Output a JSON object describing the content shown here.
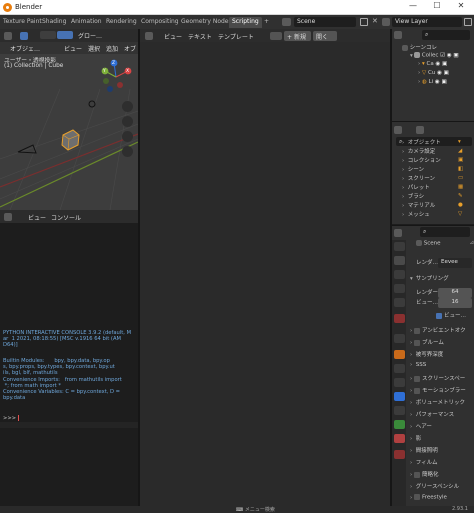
{
  "app": {
    "title": "Blender",
    "version": "2.93.1"
  },
  "window_buttons": [
    "—",
    "☐",
    "✕"
  ],
  "workspace_tabs": [
    "Texture Paint",
    "Shading",
    "Animation",
    "Rendering",
    "Compositing",
    "Geometry Nodes",
    "Scripting",
    "+"
  ],
  "scene": {
    "label": "Scene",
    "view_layer": "View Layer"
  },
  "viewport": {
    "mode": "オブジェ…",
    "menus": [
      "ビュー",
      "選択",
      "追加",
      "オブ"
    ],
    "transform": "グロー…",
    "info_line1": "ユーザー・透視投影",
    "info_line2": "(1) Collection | Cube",
    "gizmo_axes": [
      "Y",
      "X",
      "Z"
    ]
  },
  "console": {
    "menus": [
      "ビュー",
      "コンソール"
    ],
    "banner": "PYTHON INTERACTIVE CONSOLE 3.9.2 (default, M\nar  1 2021, 08:18:55) [MSC v.1916 64 bit (AM\nD64)]",
    "builtins": "Builtin Modules:      bpy, bpy.data, bpy.op\ns, bpy.props, bpy.types, bpy.context, bpy.ut\nils, bgl, blf, mathutils\nConvenience Imports:   from mathutils import\n *; from math import *\nConvenience Variables: C = bpy.context, D =\nbpy.data",
    "prompt": ">>> "
  },
  "text_editor": {
    "menus": [
      "ビュー",
      "テキスト",
      "テンプレート"
    ],
    "new_label": "新規",
    "open_label": "開く"
  },
  "outliner": {
    "title": "シーンコレ",
    "items": [
      {
        "label": "Collec"
      },
      {
        "label": "Ca"
      },
      {
        "label": "Cu"
      },
      {
        "label": "Li"
      }
    ]
  },
  "data_browser": {
    "items": [
      "オブジェクト",
      "カメラ設定",
      "コレクション",
      "シーン",
      "スクリーン",
      "パレット",
      "ブラシ",
      "マテリアル",
      "メッシュ"
    ]
  },
  "properties": {
    "scene_label": "Scene",
    "render_engine_label": "レンダ…",
    "render_engine_value": "Eevee",
    "sampling": "サンプリング",
    "render_samples_label": "レンダー",
    "render_samples": "64",
    "viewport_samples_label": "ビュー…",
    "viewport_samples": "16",
    "viewport_denoise": "ビュー…",
    "panels": [
      "アンビエントオク",
      "ブルーム",
      "被写界深度",
      "SSS",
      "スクリーンスペー",
      "モーションブラー",
      "ボリューメトリック",
      "パフォーマンス",
      "ヘアー",
      "影",
      "間接照明",
      "フィルム",
      "簡略化",
      "グリースペンシル",
      "Freestyle"
    ]
  },
  "status_bar": {
    "menu_search": "メニュー検索",
    "version": "2.93.1"
  },
  "colors": {
    "accent": "#4772b3",
    "orange": "#e87d0d",
    "console_text": "#6fa8dc",
    "prompt": "#e05050"
  }
}
